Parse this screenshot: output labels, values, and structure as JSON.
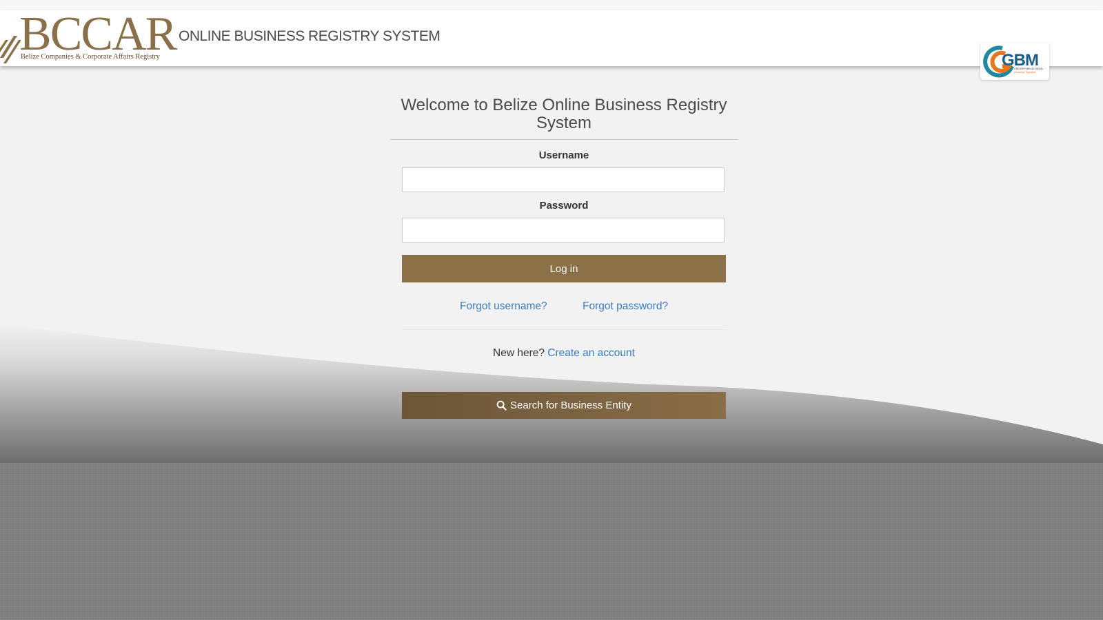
{
  "header": {
    "logo": {
      "text": "BCCAR",
      "subtitle": "Belize Companies & Corporate Affairs Registry"
    },
    "system_title": "ONLINE BUSINESS REGISTRY SYSTEM",
    "partner_logo": {
      "text": "GBM",
      "small_text": "GREATER BELIZE MEDIA",
      "tagline": "Growing Together"
    }
  },
  "login": {
    "welcome": "Welcome to Belize Online Business Registry System",
    "username_label": "Username",
    "username_value": "",
    "password_label": "Password",
    "password_value": "",
    "login_button": "Log in",
    "forgot_username": "Forgot username?",
    "forgot_password": "Forgot password?",
    "new_here": "New here?",
    "create_account": "Create an account",
    "search_button": "Search for Business Entity",
    "search_icon": "search-icon"
  },
  "colors": {
    "brand_brown": "#8c7048",
    "link_blue": "#3a7cc2",
    "text_gray": "#4a4a4a"
  }
}
